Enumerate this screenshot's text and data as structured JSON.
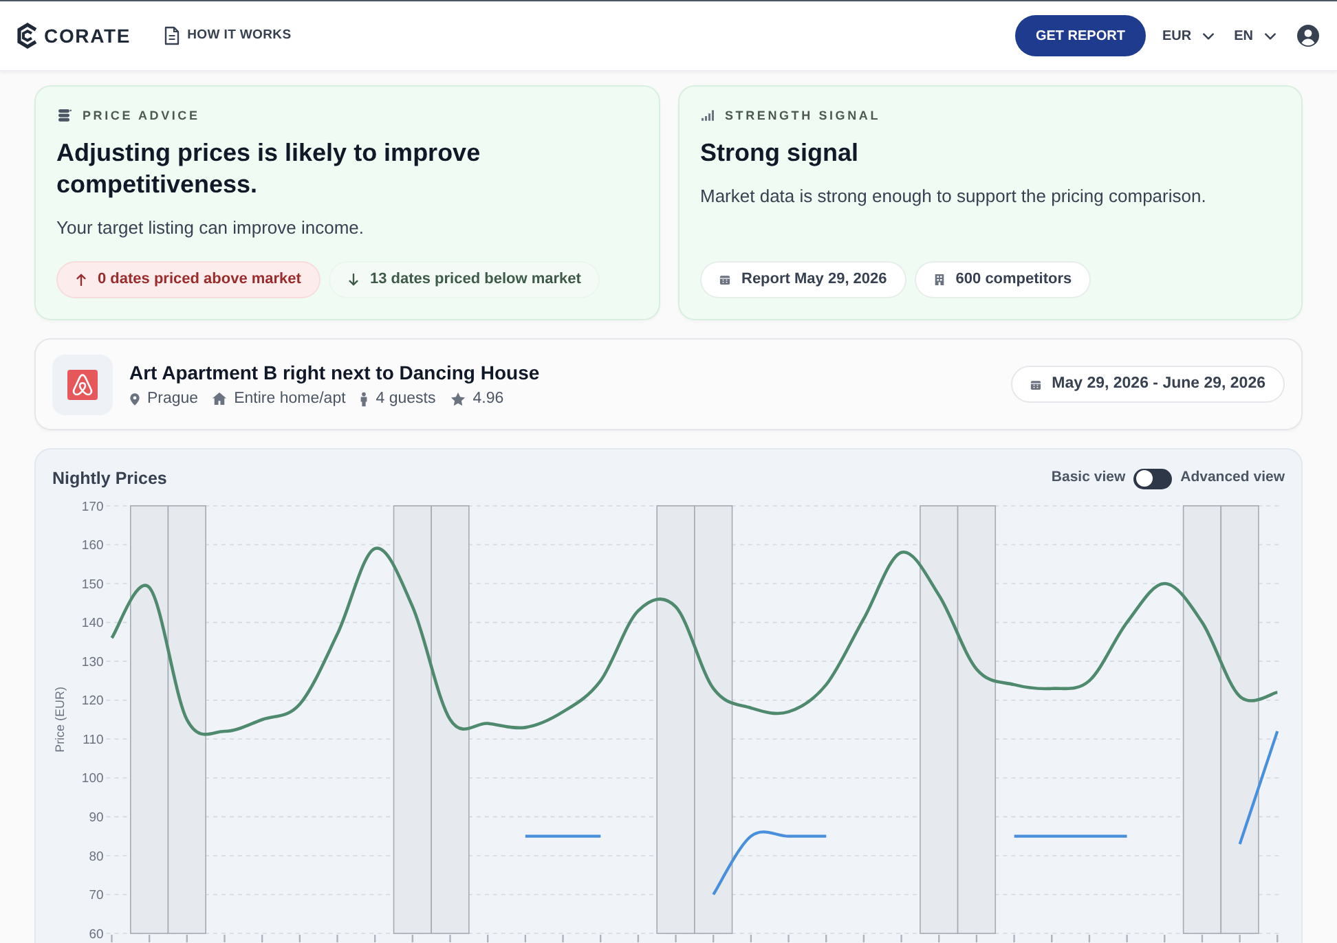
{
  "header": {
    "logo_text": "CORATE",
    "nav_link": "HOW IT WORKS",
    "cta_button": "GET REPORT",
    "currency": "EUR",
    "language": "EN"
  },
  "price_advice": {
    "label": "PRICE ADVICE",
    "heading": "Adjusting prices is likely to improve competitiveness.",
    "text": "Your target listing can improve income.",
    "pills": [
      {
        "kind": "up",
        "text": "0 dates priced above market"
      },
      {
        "kind": "down",
        "text": "13 dates priced below market"
      }
    ]
  },
  "strength_signal": {
    "label": "STRENGTH SIGNAL",
    "heading": "Strong signal",
    "text": "Market data is strong enough to support the pricing comparison.",
    "pills": [
      {
        "kind": "calendar",
        "text": "Report May 29, 2026"
      },
      {
        "kind": "building",
        "text": "600 competitors"
      }
    ]
  },
  "listing": {
    "title": "Art Apartment B right next to Dancing House",
    "details": [
      {
        "kind": "location",
        "text": "Prague"
      },
      {
        "kind": "home",
        "text": "Entire home/apt"
      },
      {
        "kind": "guests",
        "text": "4 guests"
      },
      {
        "kind": "rating",
        "text": "4.96"
      }
    ],
    "date_range": "May 29, 2026 - June 29, 2026"
  },
  "chart_panel": {
    "view_toggle": {
      "left_label": "Basic view",
      "right_label": "Advanced view",
      "on": false
    },
    "day_columns": [
      {
        "shaded": false
      },
      {
        "shaded": true
      },
      {
        "shaded": true
      },
      {
        "shaded": false
      },
      {
        "shaded": false
      },
      {
        "shaded": false
      },
      {
        "shaded": false
      },
      {
        "shaded": false
      },
      {
        "shaded": true
      },
      {
        "shaded": true
      },
      {
        "shaded": false
      },
      {
        "shaded": false
      },
      {
        "shaded": false
      },
      {
        "shaded": false
      },
      {
        "shaded": false
      },
      {
        "shaded": true
      },
      {
        "shaded": true
      },
      {
        "shaded": false
      },
      {
        "shaded": false
      },
      {
        "shaded": false
      },
      {
        "shaded": false
      },
      {
        "shaded": false
      },
      {
        "shaded": true
      },
      {
        "shaded": true
      },
      {
        "shaded": false
      },
      {
        "shaded": false
      },
      {
        "shaded": false
      },
      {
        "shaded": false
      },
      {
        "shaded": false
      },
      {
        "shaded": true
      },
      {
        "shaded": true
      },
      {
        "shaded": false
      }
    ],
    "chart_data": {
      "type": "line",
      "title": "Nightly Prices",
      "ylabel": "Price (EUR)",
      "ylim": [
        60,
        170
      ],
      "yticks": [
        60,
        70,
        80,
        90,
        100,
        110,
        120,
        130,
        140,
        150,
        160,
        170
      ],
      "grid": true,
      "series": [
        {
          "color": "#4f8a6e",
          "values": [
            136,
            149,
            115,
            112,
            115,
            119,
            137,
            159,
            144,
            115,
            114,
            113,
            117,
            125,
            143,
            144,
            123,
            118,
            117,
            124,
            141,
            158,
            147,
            128,
            124,
            123,
            125,
            140,
            150,
            140,
            121,
            122
          ]
        },
        {
          "color": "#4a8fdb",
          "values": [
            null,
            null,
            null,
            null,
            null,
            null,
            null,
            null,
            null,
            null,
            null,
            85,
            85,
            85,
            null,
            null,
            70,
            85,
            85,
            85,
            null,
            null,
            null,
            null,
            85,
            85,
            85,
            85,
            null,
            null,
            83,
            112
          ]
        }
      ]
    }
  }
}
